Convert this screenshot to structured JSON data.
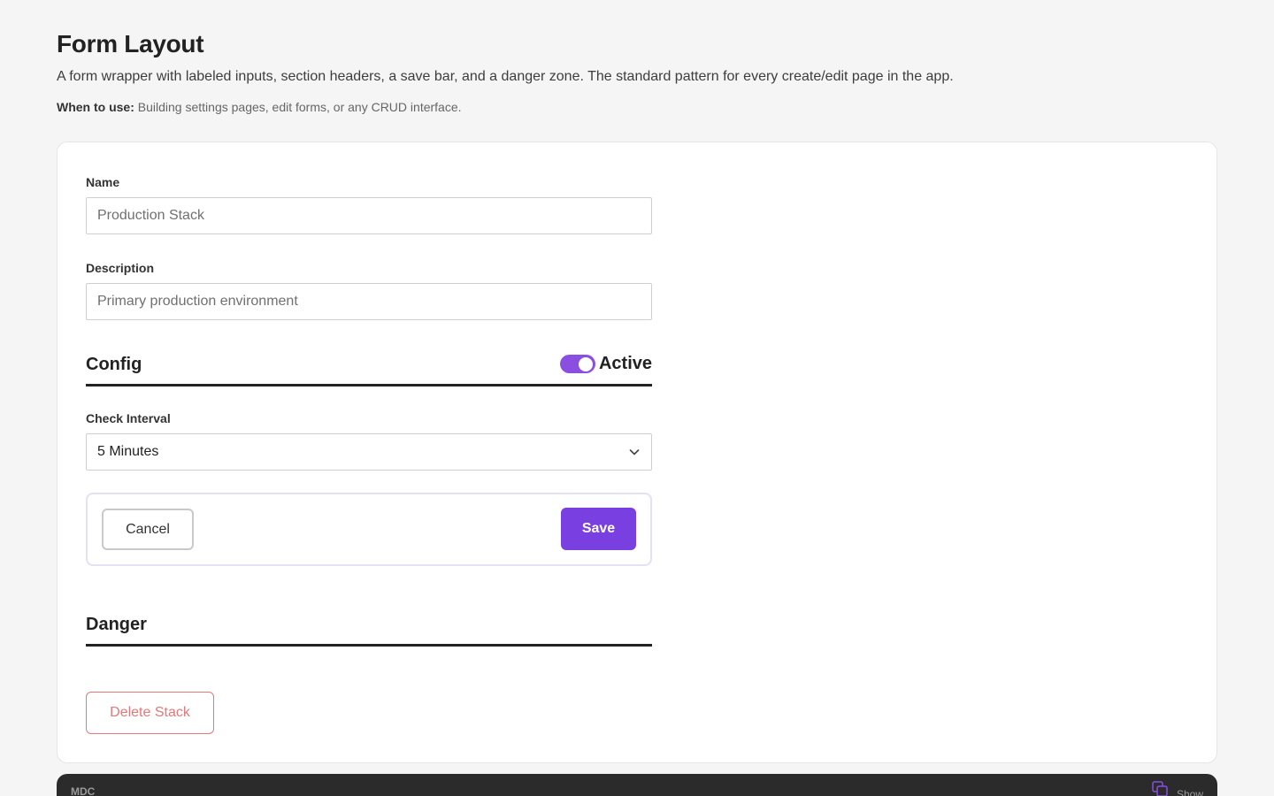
{
  "header": {
    "title": "Form Layout",
    "description": "A form wrapper with labeled inputs, section headers, a save bar, and a danger zone. The standard pattern for every create/edit page in the app.",
    "when_to_use_label": "When to use:",
    "when_to_use_text": " Building settings pages, edit forms, or any CRUD interface."
  },
  "form": {
    "name_label": "Name",
    "name_placeholder": "Production Stack",
    "description_label": "Description",
    "description_placeholder": "Primary production environment",
    "config_section_title": "Config",
    "active_toggle_label": "Active",
    "active_toggle_on": true,
    "check_interval_label": "Check Interval",
    "check_interval_value": "5 Minutes",
    "cancel_label": "Cancel",
    "save_label": "Save",
    "danger_section_title": "Danger",
    "delete_label": "Delete Stack"
  },
  "code_panel": {
    "language": "MDC",
    "show_label": "Show"
  },
  "colors": {
    "accent": "#7a3fe0",
    "toggle": "#8a4fe0",
    "danger": "#e57878",
    "background": "#f5f5f5"
  }
}
